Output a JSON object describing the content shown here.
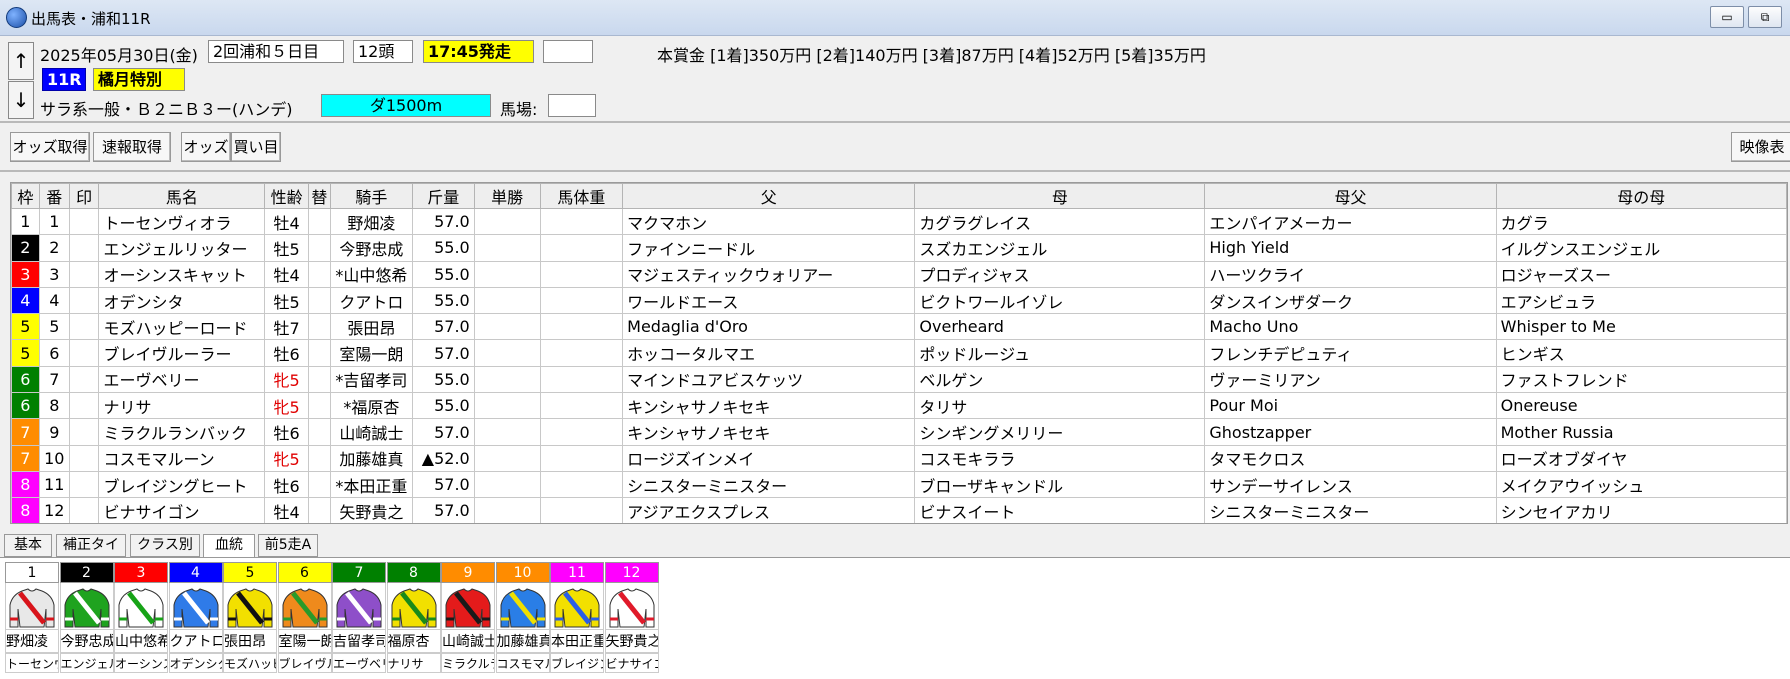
{
  "window": {
    "title": "出馬表・浦和11R",
    "minimize": "▭",
    "restore": "⧉"
  },
  "header": {
    "date": "2025年05月30日(金)",
    "meeting": "2回浦和５日目",
    "runners": "12頭",
    "post_time": "17:45発走",
    "blank_box": "",
    "prize_text": "本賞金 [1着]350万円 [2着]140万円 [3着]87万円 [4着]52万円 [5着]35万円",
    "race_no": "11R",
    "race_name": "橘月特別",
    "race_class": "サラ系一般・Ｂ２ニＢ３ー(ハンデ)",
    "distance": "ダ1500m",
    "track_label": "馬場:",
    "track_value": "",
    "up_arrow": "↑",
    "down_arrow": "↓"
  },
  "toolbar": {
    "odds_fetch": "オッズ取得",
    "realtime_fetch": "速報取得",
    "odds": "オッズ",
    "bet": "買い目",
    "video": "映像表"
  },
  "table": {
    "headers": [
      "枠",
      "番",
      "印",
      "馬名",
      "性齢",
      "替",
      "騎手",
      "斤量",
      "単勝",
      "馬体重",
      "父",
      "母",
      "母父",
      "母の母"
    ],
    "rows": [
      {
        "waku": "1",
        "num": "1",
        "mark": "",
        "name": "トーセンヴィオラ",
        "sex": "牡4",
        "fem": false,
        "jockey": "野畑凌",
        "weight": "57.0",
        "win": "",
        "bw": "",
        "sire": "マクマホン",
        "dam": "カグラグレイス",
        "damsire": "エンパイアメーカー",
        "damdam": "カグラ"
      },
      {
        "waku": "2",
        "num": "2",
        "mark": "",
        "name": "エンジェルリッター",
        "sex": "牡5",
        "fem": false,
        "jockey": "今野忠成",
        "weight": "55.0",
        "win": "",
        "bw": "",
        "sire": "ファインニードル",
        "dam": "スズカエンジェル",
        "damsire": "High Yield",
        "damdam": "イルグンスエンジェル"
      },
      {
        "waku": "3",
        "num": "3",
        "mark": "",
        "name": "オーシンスキャット",
        "sex": "牡4",
        "fem": false,
        "jockey": "*山中悠希",
        "weight": "55.0",
        "win": "",
        "bw": "",
        "sire": "マジェスティックウォリアー",
        "dam": "プロディジャス",
        "damsire": "ハーツクライ",
        "damdam": "ロジャーズスー"
      },
      {
        "waku": "4",
        "num": "4",
        "mark": "",
        "name": "オデンシタ",
        "sex": "牡5",
        "fem": false,
        "jockey": "クアトロ",
        "weight": "55.0",
        "win": "",
        "bw": "",
        "sire": "ワールドエース",
        "dam": "ビクトワールイゾレ",
        "damsire": "ダンスインザダーク",
        "damdam": "エアシビュラ"
      },
      {
        "waku": "5",
        "num": "5",
        "mark": "",
        "name": "モズハッピーロード",
        "sex": "牡7",
        "fem": false,
        "jockey": "張田昂",
        "weight": "57.0",
        "win": "",
        "bw": "",
        "sire": "Medaglia d'Oro",
        "dam": "Overheard",
        "damsire": "Macho Uno",
        "damdam": "Whisper to Me"
      },
      {
        "waku": "5",
        "num": "6",
        "mark": "",
        "name": "ブレイヴルーラー",
        "sex": "牡6",
        "fem": false,
        "jockey": "室陽一朗",
        "weight": "57.0",
        "win": "",
        "bw": "",
        "sire": "ホッコータルマエ",
        "dam": "ポッドルージュ",
        "damsire": "フレンチデピュティ",
        "damdam": "ヒンギス"
      },
      {
        "waku": "6",
        "num": "7",
        "mark": "",
        "name": "エーヴベリー",
        "sex": "牝5",
        "fem": true,
        "jockey": "*吉留孝司",
        "weight": "55.0",
        "win": "",
        "bw": "",
        "sire": "マインドユアビスケッツ",
        "dam": "ベルゲン",
        "damsire": "ヴァーミリアン",
        "damdam": "ファストフレンド"
      },
      {
        "waku": "6",
        "num": "8",
        "mark": "",
        "name": "ナリサ",
        "sex": "牝5",
        "fem": true,
        "jockey": "*福原杏",
        "weight": "55.0",
        "win": "",
        "bw": "",
        "sire": "キンシャサノキセキ",
        "dam": "タリサ",
        "damsire": "Pour Moi",
        "damdam": "Onereuse"
      },
      {
        "waku": "7",
        "num": "9",
        "mark": "",
        "name": "ミラクルランバック",
        "sex": "牡6",
        "fem": false,
        "jockey": "山崎誠士",
        "weight": "57.0",
        "win": "",
        "bw": "",
        "sire": "キンシャサノキセキ",
        "dam": "シンギングメリリー",
        "damsire": "Ghostzapper",
        "damdam": "Mother Russia"
      },
      {
        "waku": "7",
        "num": "10",
        "mark": "",
        "name": "コスモマルーン",
        "sex": "牝5",
        "fem": true,
        "jockey": "加藤雄真",
        "weight": "▲52.0",
        "win": "",
        "bw": "",
        "sire": "ロージズインメイ",
        "dam": "コスモキララ",
        "damsire": "タマモクロス",
        "damdam": "ローズオブダイヤ"
      },
      {
        "waku": "8",
        "num": "11",
        "mark": "",
        "name": "ブレイジングヒート",
        "sex": "牡6",
        "fem": false,
        "jockey": "*本田正重",
        "weight": "57.0",
        "win": "",
        "bw": "",
        "sire": "シニスターミニスター",
        "dam": "ブローザキャンドル",
        "damsire": "サンデーサイレンス",
        "damdam": "メイクアウイッシュ"
      },
      {
        "waku": "8",
        "num": "12",
        "mark": "",
        "name": "ビナサイゴン",
        "sex": "牡4",
        "fem": false,
        "jockey": "矢野貴之",
        "weight": "57.0",
        "win": "",
        "bw": "",
        "sire": "アジアエクスプレス",
        "dam": "ビナスイート",
        "damsire": "シニスターミニスター",
        "damdam": "シンセイアカリ"
      }
    ]
  },
  "waku_colors": {
    "1": {
      "bg": "#ffffff",
      "fg": "#000000"
    },
    "2": {
      "bg": "#000000",
      "fg": "#ffffff"
    },
    "3": {
      "bg": "#ff0000",
      "fg": "#ffffff"
    },
    "4": {
      "bg": "#0000ff",
      "fg": "#ffffff"
    },
    "5": {
      "bg": "#ffff00",
      "fg": "#000000"
    },
    "6": {
      "bg": "#008000",
      "fg": "#ffffff"
    },
    "7": {
      "bg": "#ff8c00",
      "fg": "#ffffff"
    },
    "8": {
      "bg": "#ff00ff",
      "fg": "#ffffff"
    }
  },
  "tabs": [
    "基本",
    "補正タイム",
    "クラス別着",
    "血統",
    "前5走A"
  ],
  "active_tab": "血統",
  "silks": [
    {
      "num": "1",
      "jockey": "野畑凌",
      "horse": "トーセンヴ",
      "body": "#e8e8e8",
      "accent": "#d8141b"
    },
    {
      "num": "2",
      "jockey": "今野忠成",
      "horse": "エンジェル",
      "body": "#1fa31f",
      "accent": "#ffffff"
    },
    {
      "num": "3",
      "jockey": "山中悠希",
      "horse": "オーシンス",
      "body": "#ffffff",
      "accent": "#17a317"
    },
    {
      "num": "4",
      "jockey": "クアトロ",
      "horse": "オデンシタ",
      "body": "#2f7be8",
      "accent": "#ffffff"
    },
    {
      "num": "5",
      "jockey": "張田昂",
      "horse": "モズハッピ",
      "body": "#f2e000",
      "accent": "#111111"
    },
    {
      "num": "6",
      "jockey": "室陽一朗",
      "horse": "ブレイヴル",
      "body": "#ef8a1c",
      "accent": "#2a9a2a"
    },
    {
      "num": "7",
      "jockey": "吉留孝司",
      "horse": "エーヴベリ",
      "body": "#8e4fc9",
      "accent": "#ffffff"
    },
    {
      "num": "8",
      "jockey": "福原杏",
      "horse": "ナリサ",
      "body": "#f2e000",
      "accent": "#1a8a1a"
    },
    {
      "num": "9",
      "jockey": "山崎誠士",
      "horse": "ミラクルラ",
      "body": "#e41b1b",
      "accent": "#1a1a1a"
    },
    {
      "num": "10",
      "jockey": "加藤雄真",
      "horse": "コスモマル",
      "body": "#2a7ee6",
      "accent": "#f0e000"
    },
    {
      "num": "11",
      "jockey": "本田正重",
      "horse": "ブレイジン",
      "body": "#f2e000",
      "accent": "#2a5ee6"
    },
    {
      "num": "12",
      "jockey": "矢野貴之",
      "horse": "ビナサイゴ",
      "body": "#ffffff",
      "accent": "#e01a2a"
    }
  ]
}
